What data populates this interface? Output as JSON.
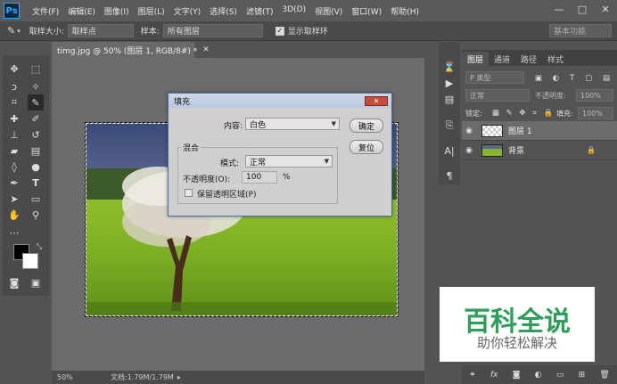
{
  "app": {
    "logo": "Ps"
  },
  "menu": [
    "文件(F)",
    "编辑(E)",
    "图像(I)",
    "图层(L)",
    "文字(Y)",
    "选择(S)",
    "滤镜(T)",
    "3D(D)",
    "视图(V)",
    "窗口(W)",
    "帮助(H)"
  ],
  "window_buttons": [
    "—",
    "□",
    "✕"
  ],
  "options_bar": {
    "sample_size_label": "取样大小:",
    "sample_size_value": "取样点",
    "sample_label": "样本:",
    "sample_value": "所有图层",
    "show_ring_label": "显示取样环",
    "workspace": "基本功能"
  },
  "document": {
    "tab_title": "timg.jpg @ 50% (图层 1, RGB/8#) *",
    "zoom": "50%",
    "doc_size": "文档:1.79M/1.79M"
  },
  "dialog": {
    "title": "填充",
    "close": "✕",
    "content_label": "内容:",
    "content_value": "白色",
    "blend_group": "混合",
    "mode_label": "模式:",
    "mode_value": "正常",
    "opacity_label": "不透明度(O):",
    "opacity_value": "100",
    "opacity_unit": "%",
    "preserve_label": "保留透明区域(P)",
    "ok": "确定",
    "reset": "复位"
  },
  "layers_panel": {
    "tabs": [
      "图层",
      "通道",
      "路径",
      "样式"
    ],
    "kind_label": "P 类型",
    "blend_mode": "正常",
    "opacity_label": "不透明度:",
    "opacity_value": "100%",
    "lock_label": "锁定:",
    "fill_label": "填充:",
    "fill_value": "100%",
    "layers": [
      {
        "name": "图层 1",
        "selected": true
      },
      {
        "name": "背景",
        "locked": true
      }
    ]
  },
  "watermark": {
    "title": "百科全说",
    "subtitle": "助你轻松解决"
  },
  "colors": {
    "dialog_bg": "#cfcfcf",
    "selected_layer": "#6b6b6b",
    "watermark_green": "#2f9e5a"
  }
}
